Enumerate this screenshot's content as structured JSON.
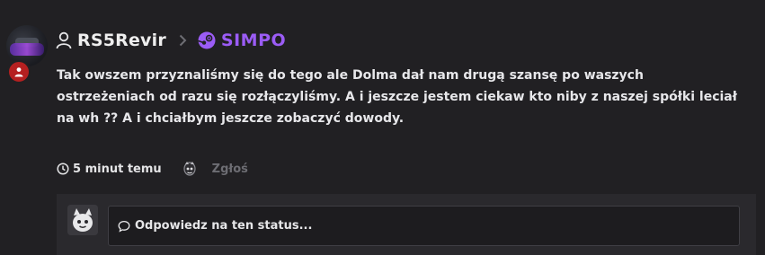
{
  "post": {
    "author": "RS5Revir",
    "group": "SIMPO",
    "message": "Tak owszem przyznaliśmy się do tego ale Dolma dał nam drugą szansę po waszych ostrzeżeniach od razu się rozłączyliśmy. A i jeszcze jestem ciekaw kto niby z naszej spółki leciał na wh ?? A i chciałbym jeszcze zobaczyć dowody.",
    "time": "5 minut temu",
    "report_label": "Zgłoś"
  },
  "reply": {
    "placeholder": "Odpowiedz na ten status..."
  },
  "icons": {
    "author": "user-icon",
    "separator": "chevron-right-icon",
    "group": "steam-icon",
    "time": "clock-icon",
    "reaction": "reaction-icon",
    "reply": "comment-icon",
    "badge": "user-badge-icon"
  },
  "colors": {
    "accent": "#9b5cf5",
    "badge": "#b52020",
    "background": "#212023"
  }
}
